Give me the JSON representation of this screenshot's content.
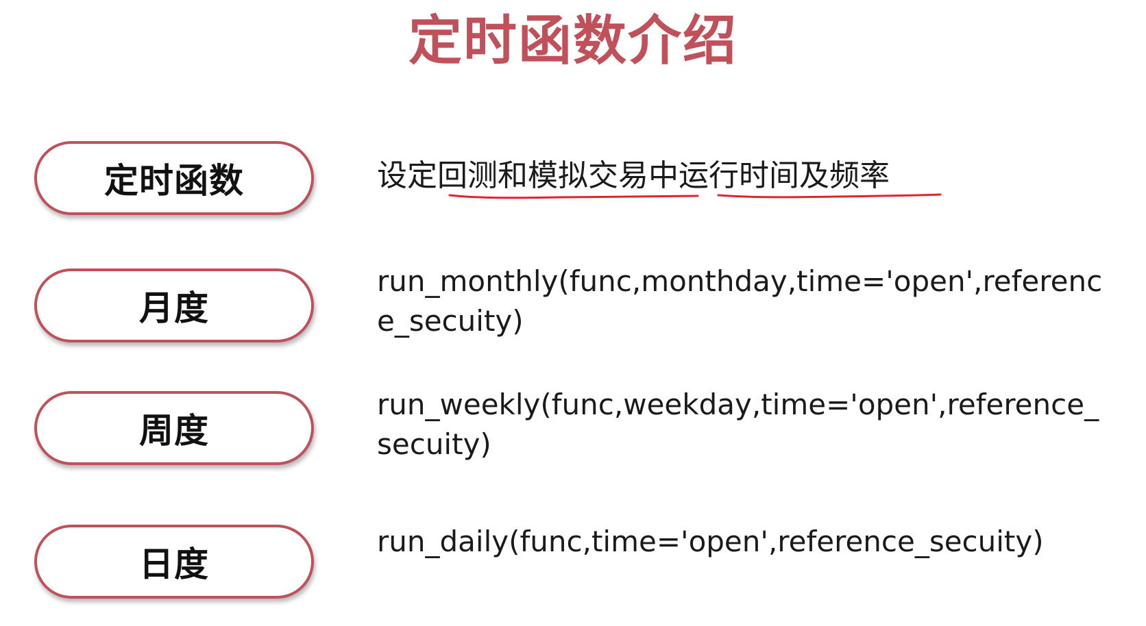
{
  "title": "定时函数介绍",
  "colors": {
    "title": "#c0505a",
    "pill_border": "#c0505a",
    "underline": "#e0242b",
    "text": "#1a1a1a"
  },
  "rows": [
    {
      "label": "定时函数",
      "description": "设定回测和模拟交易中运行时间及频率"
    },
    {
      "label": "月度",
      "description": "run_monthly(func,monthday,time='open',reference_secuity)"
    },
    {
      "label": "周度",
      "description": "run_weekly(func,weekday,time='open',reference_secuity)"
    },
    {
      "label": "日度",
      "description": "run_daily(func,time='open',reference_secuity)"
    }
  ]
}
